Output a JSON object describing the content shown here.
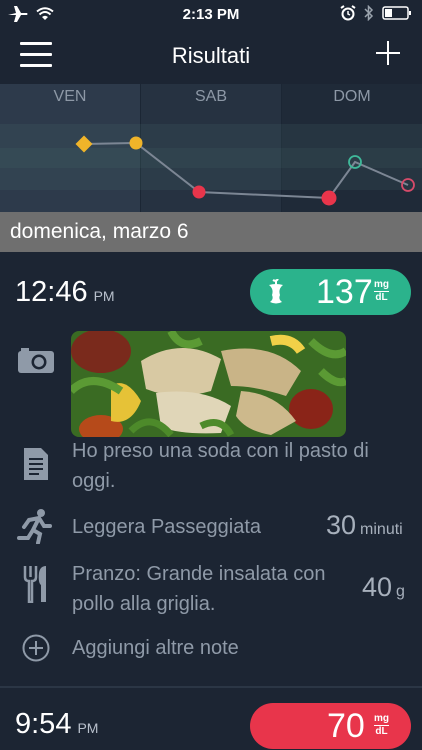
{
  "status_bar": {
    "time": "2:13 PM"
  },
  "navbar": {
    "title": "Risultati"
  },
  "chart": {
    "days": [
      "VEN",
      "SAB",
      "DOM"
    ],
    "colors": {
      "diamond": "#f0b429",
      "dot_yellow": "#f0b429",
      "dot_red": "#e8354b",
      "dot_green": "#3fb99a",
      "dot_pink": "#d64b6a",
      "line": "#7c8694"
    }
  },
  "chart_data": {
    "type": "scatter",
    "categories": [
      "VEN",
      "SAB",
      "DOM"
    ],
    "series": [
      {
        "points": [
          {
            "day": "VEN",
            "marker": "diamond",
            "level": "high"
          },
          {
            "day": "VEN",
            "marker": "dot-yellow",
            "level": "high"
          },
          {
            "day": "SAB",
            "marker": "dot-red",
            "level": "low"
          },
          {
            "day": "DOM",
            "marker": "dot-red",
            "level": "low"
          },
          {
            "day": "DOM",
            "marker": "ring-green",
            "level": "mid"
          },
          {
            "day": "DOM",
            "marker": "ring-pink",
            "level": "mid"
          }
        ]
      }
    ]
  },
  "date_header": "domenica, marzo 6",
  "entries": [
    {
      "time": "12:46",
      "ampm": "PM",
      "glucose": "137",
      "unit_top": "mg",
      "unit_bottom": "dL",
      "color": "#2bb38c",
      "note": "Ho preso una soda con il pasto di oggi.",
      "activity": "Leggera Passeggiata",
      "activity_value": "30",
      "activity_unit": "minuti",
      "meal": "Pranzo: Grande insalata con pollo alla griglia.",
      "meal_value": "40",
      "meal_unit": "g",
      "add_notes": "Aggiungi altre note"
    },
    {
      "time": "9:54",
      "ampm": "PM",
      "glucose": "70",
      "unit_top": "mg",
      "unit_bottom": "dL",
      "color": "#e8354b"
    }
  ]
}
